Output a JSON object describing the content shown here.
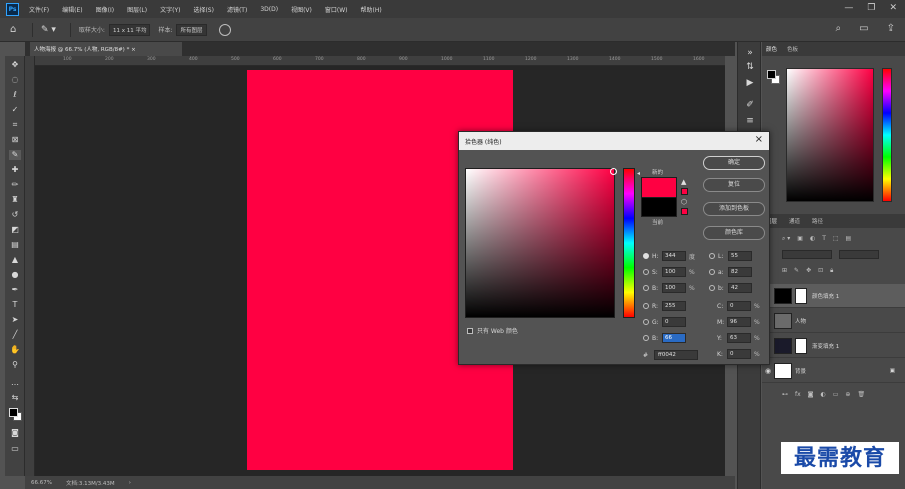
{
  "app": {
    "logo": "Ps"
  },
  "menu": [
    "文件(F)",
    "编辑(E)",
    "图像(I)",
    "图层(L)",
    "文字(Y)",
    "选择(S)",
    "滤镜(T)",
    "3D(D)",
    "视图(V)",
    "窗口(W)",
    "帮助(H)"
  ],
  "window_controls": [
    "—",
    "❐",
    "✕"
  ],
  "options_bar": {
    "size_label": "取样大小:",
    "size_value": "11 x 11 平均",
    "sample_label": "样本:",
    "sample_value": "所有图层"
  },
  "document": {
    "tab_title": "人物海报 @ 66.7% (人物, RGB/8#) *  ×",
    "fill_color": "#ff0042"
  },
  "ruler_numbers": [
    "100",
    "200",
    "300",
    "400",
    "500",
    "600",
    "700",
    "800",
    "900",
    "1000",
    "1100",
    "1200",
    "1300",
    "1400",
    "1500",
    "1600"
  ],
  "status": {
    "zoom": "66.67%",
    "doc": "文档:3.13M/3.43M"
  },
  "color_panel": {
    "tabs": [
      "颜色",
      "色板"
    ]
  },
  "layers_panel": {
    "tabs": [
      "图层",
      "通道",
      "路径"
    ],
    "layers": [
      {
        "name": "颜色填充 1",
        "thumb": "#000000",
        "selected": true
      },
      {
        "name": "人物",
        "thumb": "#6b6b6b",
        "selected": false
      },
      {
        "name": "渐变填充 1",
        "thumb": "#1a1a2a",
        "selected": false
      },
      {
        "name": "背景",
        "thumb": "#ffffff",
        "selected": false
      }
    ]
  },
  "color_picker": {
    "title": "拾色器 (纯色)",
    "label_new": "新的",
    "label_current": "当前",
    "new_color": "#ff0042",
    "current_color": "#000000",
    "hue_color": "#ff0044",
    "buttons": {
      "ok": "确定",
      "reset": "复位",
      "add_swatch": "添加到色板",
      "libraries": "颜色库"
    },
    "only_web": "只有 Web 颜色",
    "hsb": {
      "H": "344",
      "S": "100",
      "B": "100",
      "H_unit": "度",
      "S_unit": "%",
      "B_unit": "%"
    },
    "rgb": {
      "R": "255",
      "G": "0",
      "B": "66"
    },
    "lab": {
      "L": "55",
      "a": "82",
      "b": "42"
    },
    "cmyk": {
      "C": "0",
      "M": "96",
      "Y": "63",
      "K": "0",
      "unit": "%"
    },
    "hex": "ff0042"
  },
  "watermark": "最需教育"
}
